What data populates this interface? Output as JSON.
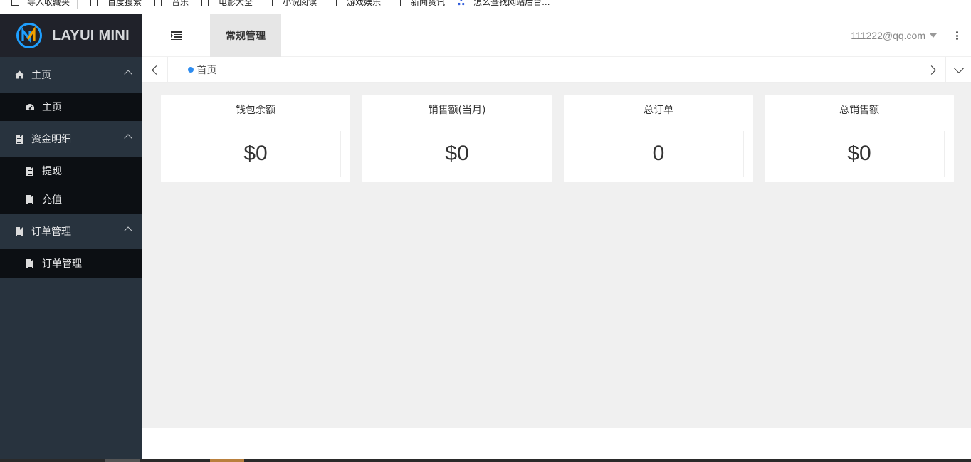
{
  "bookmarks": [
    {
      "label": "导入收藏夹",
      "icon": "import-icon"
    },
    {
      "label": "百度搜索",
      "icon": "page-icon"
    },
    {
      "label": "音乐",
      "icon": "page-icon"
    },
    {
      "label": "电影大全",
      "icon": "page-icon"
    },
    {
      "label": "小说阅读",
      "icon": "page-icon"
    },
    {
      "label": "游戏娱乐",
      "icon": "page-icon"
    },
    {
      "label": "新闻资讯",
      "icon": "page-icon"
    },
    {
      "label": "怎么查找网站后台...",
      "icon": "baidu-paw-icon"
    }
  ],
  "sidebar": {
    "logo_text": "LAYUI MINI",
    "groups": [
      {
        "label": "主页",
        "icon": "home-icon",
        "items": [
          {
            "label": "主页",
            "icon": "dashboard-icon"
          }
        ]
      },
      {
        "label": "资金明细",
        "icon": "file-icon",
        "items": [
          {
            "label": "提现",
            "icon": "file-icon"
          },
          {
            "label": "充值",
            "icon": "file-icon"
          }
        ]
      },
      {
        "label": "订单管理",
        "icon": "file-icon",
        "items": [
          {
            "label": "订单管理",
            "icon": "file-icon"
          }
        ]
      }
    ]
  },
  "header": {
    "menu_toggle_icon": "indent-icon",
    "tab_label": "常规管理",
    "user_email": "111222@qq.com",
    "more_icon": "vertical-dots-icon"
  },
  "tabstrip": {
    "home_tab": "首页"
  },
  "cards": [
    {
      "title": "钱包余额",
      "value": "$0"
    },
    {
      "title": "销售额(当月)",
      "value": "$0"
    },
    {
      "title": "总订单",
      "value": "0"
    },
    {
      "title": "总销售额",
      "value": "$0"
    }
  ],
  "colors": {
    "sidebar_bg": "#28333e",
    "logo_bg": "#20222a",
    "submenu_bg": "#0c0f13",
    "accent_dot": "#2d8cf0",
    "content_bg": "#f0f0f0"
  }
}
